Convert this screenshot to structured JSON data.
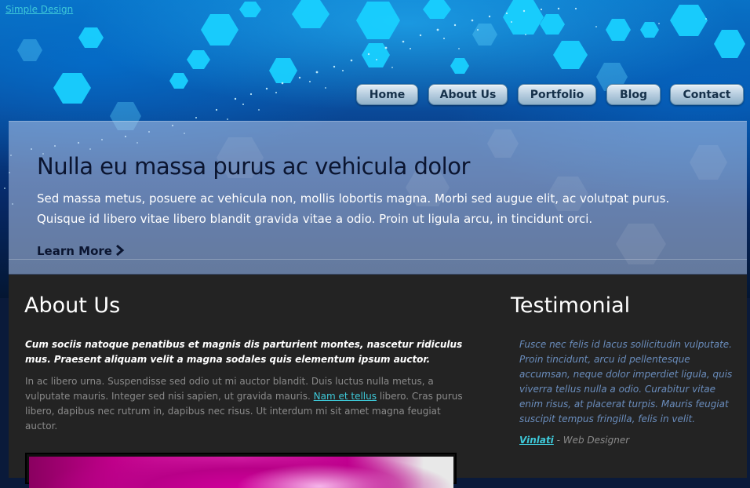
{
  "site": {
    "logo_text": "Simple Design"
  },
  "nav": {
    "items": [
      {
        "label": "Home"
      },
      {
        "label": "About Us"
      },
      {
        "label": "Portfolio"
      },
      {
        "label": "Blog"
      },
      {
        "label": "Contact"
      }
    ]
  },
  "hero": {
    "title": "Nulla eu massa purus ac vehicula dolor",
    "text": "Sed massa metus, posuere ac vehicula non, mollis lobortis magna. Morbi sed augue elit, ac volutpat purus. Quisque id libero vitae libero blandit gravida vitae a odio. Proin ut ligula arcu, in tincidunt orci.",
    "learn_more": "Learn More",
    "learn_more_icon": "chevron-right-icon"
  },
  "about": {
    "title": "About Us",
    "lead": "Cum sociis natoque penatibus et magnis dis parturient montes, nascetur ridiculus mus. Praesent aliquam velit a magna sodales quis elementum ipsum auctor.",
    "body_before": "In ac libero urna. Suspendisse sed odio ut mi auctor blandit. Duis luctus nulla metus, a vulputate mauris. Integer sed nisi sapien, ut gravida mauris. ",
    "body_link": "Nam et tellus",
    "body_after": " libero. Cras purus libero, dapibus nec rutrum in, dapibus nec risus. Ut interdum mi sit amet magna feugiat auctor."
  },
  "testimonial": {
    "title": "Testimonial",
    "quote": "Fusce nec felis id lacus sollicitudin vulputate. Proin tincidunt, arcu id pellentesque accumsan, neque dolor imperdiet ligula, quis viverra tellus nulla a odio. Curabitur vitae enim risus, at placerat turpis. Mauris feugiat suscipit tempus fringilla, felis in velit.",
    "author_name": "Vinlati",
    "author_role": " - Web Designer"
  },
  "colors": {
    "link": "#3ec9d9",
    "content_bg": "#232323",
    "testimonial_text": "#6a8dbd",
    "hero_title": "#0b1530"
  }
}
